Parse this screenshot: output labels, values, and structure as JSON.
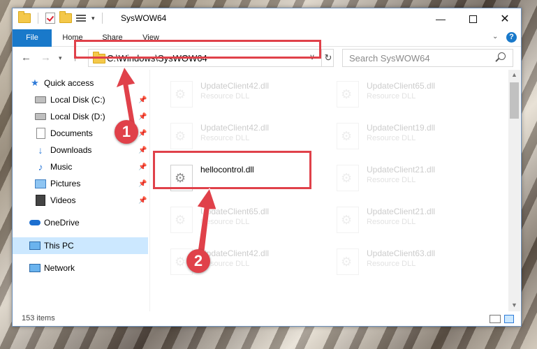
{
  "window": {
    "title": "SysWOW64"
  },
  "ribbon": {
    "tabs": [
      {
        "label": "File"
      },
      {
        "label": "Home"
      },
      {
        "label": "Share"
      },
      {
        "label": "View"
      }
    ],
    "help_label": "?",
    "chevron": "⌄"
  },
  "nav": {
    "address": "C:\\Windows\\SysWOW64",
    "search_placeholder": "Search SysWOW64",
    "back": "←",
    "forward": "→",
    "up": "↑",
    "recent": "▾",
    "refresh": "↻",
    "addr_dropdown": "∨"
  },
  "sidebar": {
    "items": [
      {
        "label": "Quick access",
        "icon": "star-icon",
        "pinned": false
      },
      {
        "label": "Local Disk (C:)",
        "icon": "drive-icon",
        "pinned": true
      },
      {
        "label": "Local Disk (D:)",
        "icon": "drive-icon",
        "pinned": true
      },
      {
        "label": "Documents",
        "icon": "documents-icon",
        "pinned": true
      },
      {
        "label": "Downloads",
        "icon": "downloads-icon",
        "pinned": true
      },
      {
        "label": "Music",
        "icon": "music-icon",
        "pinned": true
      },
      {
        "label": "Pictures",
        "icon": "pictures-icon",
        "pinned": true
      },
      {
        "label": "Videos",
        "icon": "videos-icon",
        "pinned": true
      },
      {
        "label": "OneDrive",
        "icon": "onedrive-icon",
        "pinned": false
      },
      {
        "label": "This PC",
        "icon": "pc-icon",
        "pinned": false,
        "selected": true
      },
      {
        "label": "Network",
        "icon": "network-icon",
        "pinned": false
      }
    ],
    "pin_glyph": "📌"
  },
  "files": [
    {
      "name": "UpdateClient42.dll",
      "type": "Resource DLL",
      "faded": true
    },
    {
      "name": "UpdateClient65.dll",
      "type": "Resource DLL",
      "faded": true
    },
    {
      "name": "UpdateClient42.dll",
      "type": "Resource DLL",
      "faded": true
    },
    {
      "name": "UpdateClient19.dll",
      "type": "Resource DLL",
      "faded": true
    },
    {
      "name": "hellocontrol.dll",
      "type": "",
      "faded": false,
      "highlighted": true
    },
    {
      "name": "UpdateClient21.dll",
      "type": "Resource DLL",
      "faded": true
    },
    {
      "name": "UpdateClient65.dll",
      "type": "Resource DLL",
      "faded": true
    },
    {
      "name": "UpdateClient21.dll",
      "type": "Resource DLL",
      "faded": true
    },
    {
      "name": "UpdateClient42.dll",
      "type": "Resource DLL",
      "faded": true
    },
    {
      "name": "UpdateClient63.dll",
      "type": "Resource DLL",
      "faded": true
    }
  ],
  "status": {
    "item_count": "153 items"
  },
  "annotations": {
    "badge1": "1",
    "badge2": "2",
    "color": "#e0414a"
  },
  "colors": {
    "accent": "#1979ca",
    "selection": "#cce8ff"
  }
}
